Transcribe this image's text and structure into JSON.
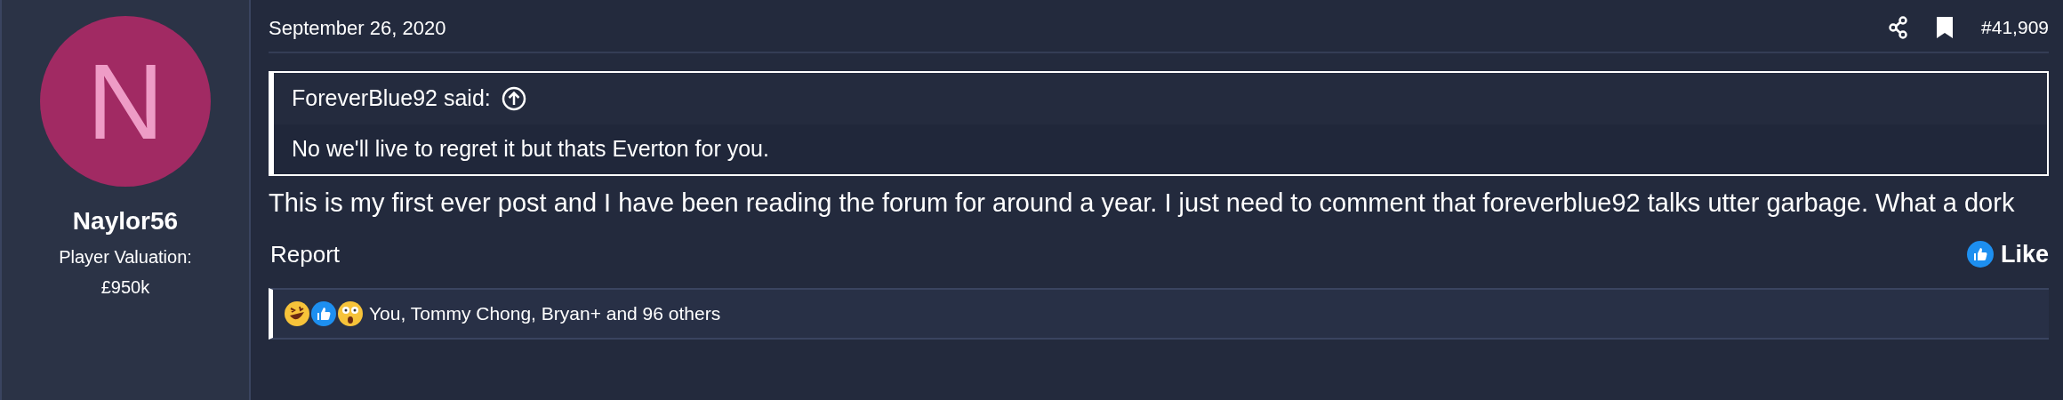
{
  "author": {
    "avatar_letter": "N",
    "name": "Naylor56",
    "title": "Player Valuation:",
    "value": "£950k"
  },
  "post": {
    "date": "September 26, 2020",
    "number": "#41,909",
    "quote": {
      "author": "ForeverBlue92 said:",
      "text": "No we'll live to regret it but thats Everton for you."
    },
    "body": "This is my first ever post and I have been reading the forum for around a year. I just need to comment that foreverblue92 talks utter garbage. What a dork",
    "actions": {
      "report": "Report",
      "like": "Like"
    },
    "reactions": "You, Tommy Chong, Bryan+ and 96 others"
  }
}
